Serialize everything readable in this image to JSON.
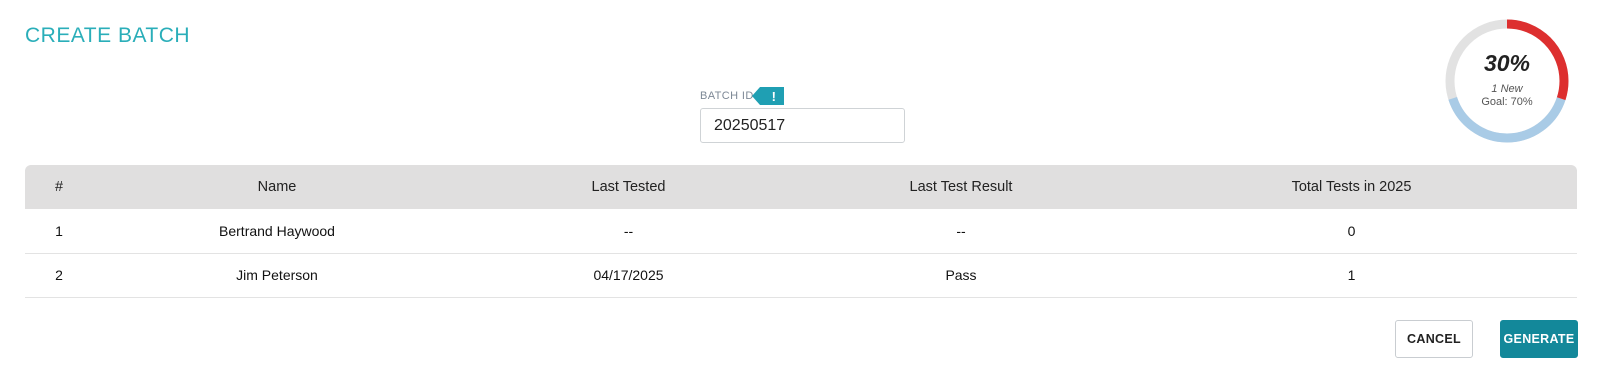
{
  "page": {
    "title": "CREATE BATCH"
  },
  "batch": {
    "label": "BATCH ID",
    "alert_glyph": "!",
    "value": "20250517"
  },
  "gauge": {
    "percent_text": "30%",
    "percent_value": 30,
    "new_text": "1 New",
    "goal_text": "Goal: 70%",
    "goal_value": 70,
    "colors": {
      "progress": "#dd2f2f",
      "goal": "#a9cbe6",
      "track": "#e2e2e2"
    }
  },
  "table": {
    "headers": [
      "#",
      "Name",
      "Last Tested",
      "Last Test Result",
      "Total Tests in 2025"
    ],
    "rows": [
      [
        "1",
        "Bertrand Haywood",
        "--",
        "--",
        "0"
      ],
      [
        "2",
        "Jim Peterson",
        "04/17/2025",
        "Pass",
        "1"
      ]
    ]
  },
  "actions": {
    "cancel_label": "CANCEL",
    "generate_label": "GENERATE"
  },
  "colors": {
    "accent": "#2aaeb9",
    "primary_button": "#13889a",
    "header_bg": "#e0dfdf"
  }
}
